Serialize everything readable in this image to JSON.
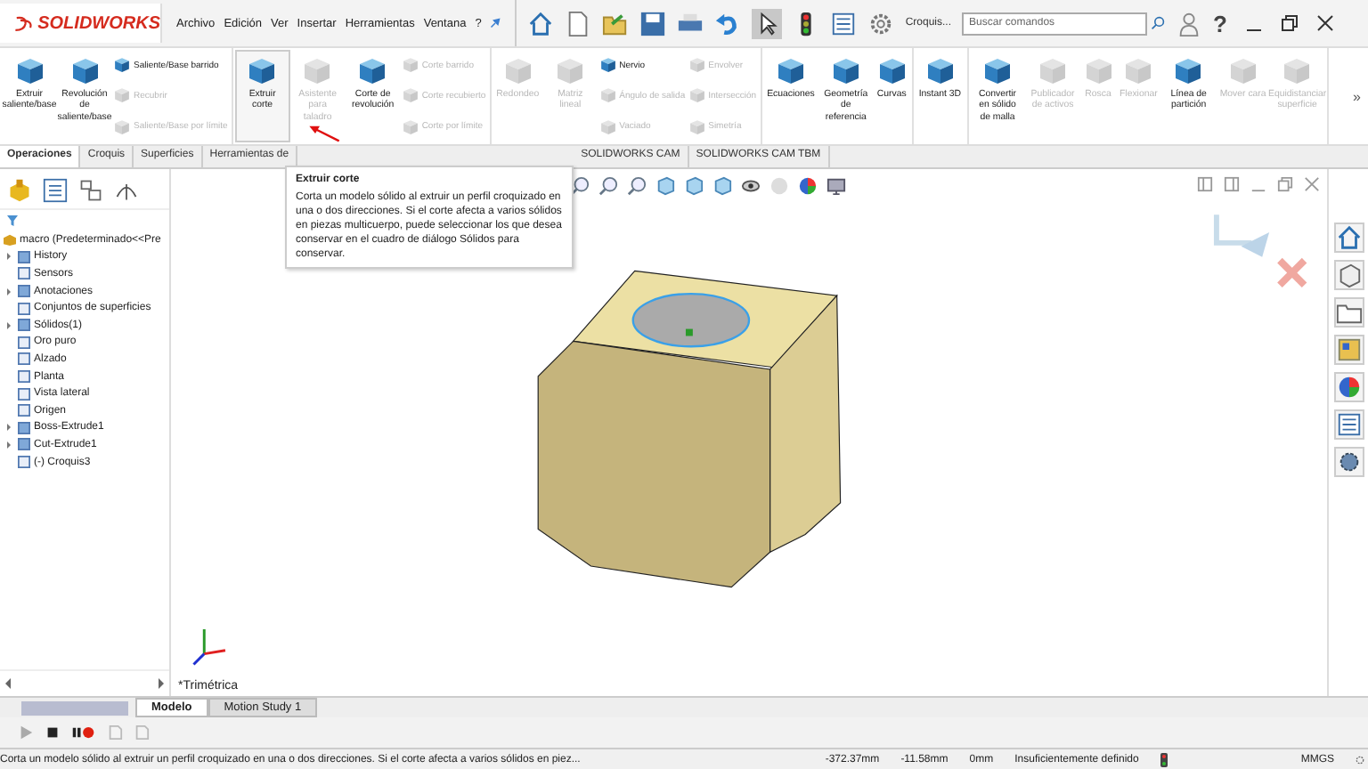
{
  "app": {
    "logo": "SOLIDWORKS"
  },
  "menu": [
    "Archivo",
    "Edición",
    "Ver",
    "Insertar",
    "Herramientas",
    "Ventana",
    "?"
  ],
  "sketch_label": "Croquis...",
  "search": {
    "placeholder": "Buscar comandos"
  },
  "help": "?",
  "ribbon": [
    {
      "items": [
        {
          "kind": "large",
          "label": "Extruir saliente/base",
          "disabled": false,
          "highlighted": false
        },
        {
          "kind": "large",
          "label": "Revolución de saliente/base",
          "disabled": false,
          "highlighted": false
        },
        {
          "kind": "stack",
          "items": [
            {
              "label": "Saliente/Base barrido",
              "disabled": false
            },
            {
              "label": "Recubrir",
              "disabled": true
            },
            {
              "label": "Saliente/Base por límite",
              "disabled": true
            }
          ]
        }
      ]
    },
    {
      "items": [
        {
          "kind": "large",
          "label": "Extruir corte",
          "disabled": false,
          "highlighted": true
        },
        {
          "kind": "large",
          "label": "Asistente para taladro",
          "disabled": true,
          "highlighted": false
        },
        {
          "kind": "large",
          "label": "Corte de revolución",
          "disabled": false,
          "highlighted": false
        },
        {
          "kind": "stack",
          "items": [
            {
              "label": "Corte barrido",
              "disabled": true
            },
            {
              "label": "Corte recubierto",
              "disabled": true
            },
            {
              "label": "Corte por límite",
              "disabled": true
            }
          ]
        }
      ]
    },
    {
      "items": [
        {
          "kind": "large",
          "label": "Redondeo",
          "disabled": true,
          "highlighted": false
        },
        {
          "kind": "large",
          "label": "Matriz lineal",
          "disabled": true,
          "highlighted": false
        },
        {
          "kind": "stack",
          "items": [
            {
              "label": "Nervio",
              "disabled": false
            },
            {
              "label": "Ángulo de salida",
              "disabled": true
            },
            {
              "label": "Vaciado",
              "disabled": true
            }
          ]
        },
        {
          "kind": "stack",
          "items": [
            {
              "label": "Envolver",
              "disabled": true
            },
            {
              "label": "Intersección",
              "disabled": true
            },
            {
              "label": "Simetría",
              "disabled": true
            }
          ]
        }
      ]
    },
    {
      "items": [
        {
          "kind": "large",
          "label": "Ecuaciones",
          "disabled": false,
          "highlighted": false
        },
        {
          "kind": "large",
          "label": "Geometría de referencia",
          "disabled": false,
          "highlighted": false
        },
        {
          "kind": "large",
          "label": "Curvas",
          "disabled": false,
          "highlighted": false
        }
      ]
    },
    {
      "items": [
        {
          "kind": "large",
          "label": "Instant 3D",
          "disabled": false,
          "highlighted": false
        }
      ]
    },
    {
      "items": [
        {
          "kind": "large",
          "label": "Convertir en sólido de malla",
          "disabled": false,
          "highlighted": false
        },
        {
          "kind": "large",
          "label": "Publicador de activos",
          "disabled": true,
          "highlighted": false
        },
        {
          "kind": "large",
          "label": "Rosca",
          "disabled": true,
          "highlighted": false
        },
        {
          "kind": "large",
          "label": "Flexionar",
          "disabled": true,
          "highlighted": false
        },
        {
          "kind": "large",
          "label": "Línea de partición",
          "disabled": false,
          "highlighted": false
        },
        {
          "kind": "large",
          "label": "Mover cara",
          "disabled": true,
          "highlighted": false
        },
        {
          "kind": "large",
          "label": "Equidistanciar superficie",
          "disabled": true,
          "highlighted": false
        }
      ]
    }
  ],
  "ribbon_more": "»",
  "tabs": [
    {
      "label": "Operaciones",
      "selected": true
    },
    {
      "label": "Croquis",
      "selected": false
    },
    {
      "label": "Superficies",
      "selected": false
    },
    {
      "label": "Herramientas de",
      "selected": false
    },
    {
      "label": "SOLIDWORKS CAM",
      "selected": false
    },
    {
      "label": "SOLIDWORKS CAM TBM",
      "selected": false
    }
  ],
  "tooltip": {
    "title": "Extruir corte",
    "text": "Corta un modelo sólido al extruir un perfil croquizado en una o dos direcciones. Si el corte afecta a varios sólidos en piezas multicuerpo, puede seleccionar los que desea conservar en el cuadro de diálogo Sólidos para conservar."
  },
  "tree": {
    "root": "macro  (Predeterminado<<Pre",
    "items": [
      {
        "label": "History",
        "kind": "group"
      },
      {
        "label": "Sensors",
        "kind": "leaf"
      },
      {
        "label": "Anotaciones",
        "kind": "group"
      },
      {
        "label": "Conjuntos de superficies",
        "kind": "leaf"
      },
      {
        "label": "Sólidos(1)",
        "kind": "group"
      },
      {
        "label": "Oro puro",
        "kind": "leaf"
      },
      {
        "label": "Alzado",
        "kind": "leaf"
      },
      {
        "label": "Planta",
        "kind": "leaf"
      },
      {
        "label": "Vista lateral",
        "kind": "leaf"
      },
      {
        "label": "Origen",
        "kind": "leaf"
      },
      {
        "label": "Boss-Extrude1",
        "kind": "group"
      },
      {
        "label": "Cut-Extrude1",
        "kind": "group"
      },
      {
        "label": "(-) Croquis3",
        "kind": "leaf"
      }
    ]
  },
  "view_name": "*Trimétrica",
  "bottom_tabs": [
    {
      "label": "Modelo",
      "selected": true
    },
    {
      "label": "Motion Study 1",
      "selected": false
    }
  ],
  "status_bar": {
    "message": "Corta un modelo sólido al extruir un perfil croquizado en una o dos direcciones. Si el corte afecta a varios sólidos en piez...",
    "x": "-372.37mm",
    "y": "-11.58mm",
    "z": "0mm",
    "state": "Insuficientemente definido",
    "units": "MMGS"
  }
}
